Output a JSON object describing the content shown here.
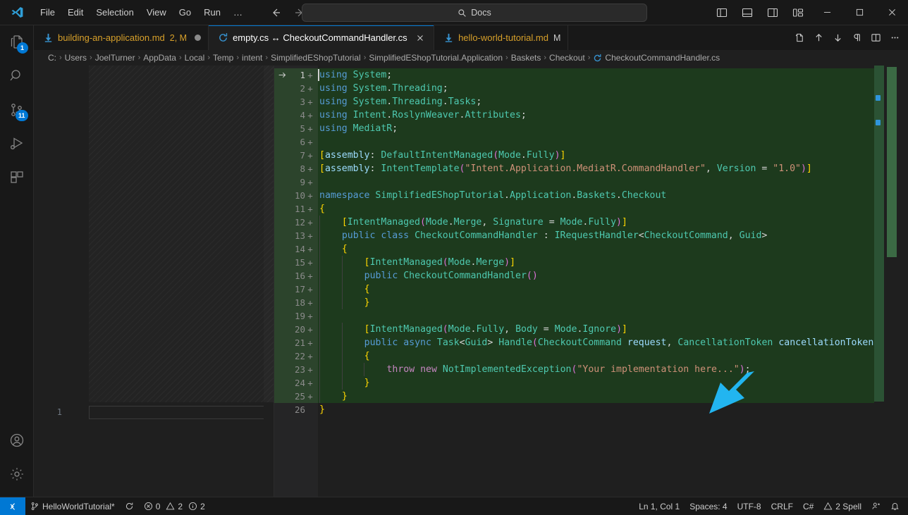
{
  "titlebar": {
    "logo_icon": "vscode-logo-icon",
    "menu": [
      {
        "label": "File"
      },
      {
        "label": "Edit"
      },
      {
        "label": "Selection"
      },
      {
        "label": "View"
      },
      {
        "label": "Go"
      },
      {
        "label": "Run"
      },
      {
        "label": "…"
      }
    ],
    "nav": {
      "back_icon": "arrow-left-icon",
      "forward_icon": "arrow-right-icon"
    },
    "search": {
      "icon": "search-icon",
      "value": "Docs",
      "placeholder": "Search"
    },
    "layout_buttons": [
      {
        "name": "toggle-primary-sidebar",
        "icon": "layout-sidebar-left-icon"
      },
      {
        "name": "toggle-panel",
        "icon": "layout-panel-icon"
      },
      {
        "name": "toggle-secondary-sidebar",
        "icon": "layout-sidebar-right-icon"
      },
      {
        "name": "customize-layout",
        "icon": "layout-customize-icon"
      }
    ],
    "window_buttons": [
      {
        "name": "minimize-button",
        "icon": "minimize-icon"
      },
      {
        "name": "maximize-button",
        "icon": "maximize-icon"
      },
      {
        "name": "close-button",
        "icon": "close-icon"
      }
    ]
  },
  "activitybar": {
    "items": [
      {
        "name": "explorer",
        "icon": "files-icon",
        "badge": "1",
        "active": false
      },
      {
        "name": "search",
        "icon": "search-icon",
        "badge": "",
        "active": false
      },
      {
        "name": "source-control",
        "icon": "source-control-icon",
        "badge": "11",
        "active": false
      },
      {
        "name": "run-and-debug",
        "icon": "run-debug-icon",
        "badge": "",
        "active": false
      },
      {
        "name": "extensions",
        "icon": "extensions-icon",
        "badge": "",
        "active": false
      }
    ],
    "bottom_items": [
      {
        "name": "accounts",
        "icon": "account-icon"
      },
      {
        "name": "manage-settings",
        "icon": "gear-icon"
      }
    ]
  },
  "tabs": [
    {
      "name": "tab-building-an-application",
      "icon": "markdown-download-icon",
      "label": "building-an-application.md",
      "suffix": "2, M",
      "dirty": true,
      "active": false,
      "closable": false
    },
    {
      "name": "tab-empty-cs-diff",
      "icon": "csharp-refresh-icon",
      "label": "empty.cs ↔ CheckoutCommandHandler.cs",
      "suffix": "",
      "dirty": false,
      "active": true,
      "closable": true
    },
    {
      "name": "tab-hello-world-tutorial",
      "icon": "markdown-download-icon",
      "label": "hello-world-tutorial.md",
      "suffix": "M",
      "dirty": false,
      "active": false,
      "closable": false
    }
  ],
  "tabbar_actions": [
    {
      "name": "new-file-button",
      "icon": "new-file-icon"
    },
    {
      "name": "previous-change-button",
      "icon": "arrow-up-icon"
    },
    {
      "name": "next-change-button",
      "icon": "arrow-down-icon"
    },
    {
      "name": "toggle-whitespace-button",
      "icon": "pilcrow-icon"
    },
    {
      "name": "split-editor-button",
      "icon": "split-editor-icon"
    },
    {
      "name": "more-actions-button",
      "icon": "ellipsis-icon"
    }
  ],
  "breadcrumbs": {
    "items": [
      {
        "label": "C:",
        "icon": ""
      },
      {
        "label": "Users",
        "icon": ""
      },
      {
        "label": "JoelTurner",
        "icon": ""
      },
      {
        "label": "AppData",
        "icon": ""
      },
      {
        "label": "Local",
        "icon": ""
      },
      {
        "label": "Temp",
        "icon": ""
      },
      {
        "label": "intent",
        "icon": ""
      },
      {
        "label": "SimplifiedEShopTutorial",
        "icon": ""
      },
      {
        "label": "SimplifiedEShopTutorial.Application",
        "icon": ""
      },
      {
        "label": "Baskets",
        "icon": ""
      },
      {
        "label": "Checkout",
        "icon": ""
      },
      {
        "label": "CheckoutCommandHandler.cs",
        "icon": "csharp-refresh-icon"
      }
    ],
    "separator": "›"
  },
  "diff": {
    "left_pane": {
      "name": "original-empty-file-pane",
      "line_numbers": [
        "1"
      ],
      "content": "",
      "is_empty": true
    },
    "right_pane": {
      "name": "modified-file-pane",
      "marker_icon": "arrow-right-icon",
      "lines": [
        {
          "n": "1",
          "added": true,
          "text": "using System;"
        },
        {
          "n": "2",
          "added": true,
          "text": "using System.Threading;"
        },
        {
          "n": "3",
          "added": true,
          "text": "using System.Threading.Tasks;"
        },
        {
          "n": "4",
          "added": true,
          "text": "using Intent.RoslynWeaver.Attributes;"
        },
        {
          "n": "5",
          "added": true,
          "text": "using MediatR;"
        },
        {
          "n": "6",
          "added": true,
          "text": ""
        },
        {
          "n": "7",
          "added": true,
          "text": "[assembly: DefaultIntentManaged(Mode.Fully)]"
        },
        {
          "n": "8",
          "added": true,
          "text": "[assembly: IntentTemplate(\"Intent.Application.MediatR.CommandHandler\", Version = \"1.0\")]"
        },
        {
          "n": "9",
          "added": true,
          "text": ""
        },
        {
          "n": "10",
          "added": true,
          "text": "namespace SimplifiedEShopTutorial.Application.Baskets.Checkout"
        },
        {
          "n": "11",
          "added": true,
          "text": "{"
        },
        {
          "n": "12",
          "added": true,
          "text": "    [IntentManaged(Mode.Merge, Signature = Mode.Fully)]"
        },
        {
          "n": "13",
          "added": true,
          "text": "    public class CheckoutCommandHandler : IRequestHandler<CheckoutCommand, Guid>"
        },
        {
          "n": "14",
          "added": true,
          "text": "    {"
        },
        {
          "n": "15",
          "added": true,
          "text": "        [IntentManaged(Mode.Merge)]"
        },
        {
          "n": "16",
          "added": true,
          "text": "        public CheckoutCommandHandler()"
        },
        {
          "n": "17",
          "added": true,
          "text": "        {"
        },
        {
          "n": "18",
          "added": true,
          "text": "        }"
        },
        {
          "n": "19",
          "added": true,
          "text": ""
        },
        {
          "n": "20",
          "added": true,
          "text": "        [IntentManaged(Mode.Fully, Body = Mode.Ignore)]"
        },
        {
          "n": "21",
          "added": true,
          "text": "        public async Task<Guid> Handle(CheckoutCommand request, CancellationToken cancellationToken)"
        },
        {
          "n": "22",
          "added": true,
          "text": "        {"
        },
        {
          "n": "23",
          "added": true,
          "text": "            throw new NotImplementedException(\"Your implementation here...\");"
        },
        {
          "n": "24",
          "added": true,
          "text": "        }"
        },
        {
          "n": "25",
          "added": true,
          "text": "    }"
        },
        {
          "n": "26",
          "added": false,
          "text": "}"
        }
      ]
    }
  },
  "annotation": {
    "name": "cyan-pointer-arrow",
    "color": "#22b5f0"
  },
  "statusbar": {
    "remote_icon": "remote-window-icon",
    "left": [
      {
        "name": "branch-status",
        "icon": "source-control-icon",
        "label": "HelloWorldTutorial*"
      },
      {
        "name": "sync-status",
        "icon": "sync-icon",
        "label": ""
      },
      {
        "name": "errors-status",
        "icon": "error-icon",
        "label": "0"
      },
      {
        "name": "warnings-status",
        "icon": "warning-icon",
        "label": "2"
      },
      {
        "name": "info-status",
        "icon": "info-icon",
        "label": "2"
      }
    ],
    "right": [
      {
        "name": "cursor-position",
        "icon": "",
        "label": "Ln 1, Col 1"
      },
      {
        "name": "indentation",
        "icon": "",
        "label": "Spaces: 4"
      },
      {
        "name": "encoding",
        "icon": "",
        "label": "UTF-8"
      },
      {
        "name": "eol",
        "icon": "",
        "label": "CRLF"
      },
      {
        "name": "language-mode",
        "icon": "",
        "label": "C#"
      },
      {
        "name": "spell-checker",
        "icon": "warning-icon",
        "label": "2 Spell"
      },
      {
        "name": "remote-share",
        "icon": "live-share-icon",
        "label": ""
      },
      {
        "name": "notifications",
        "icon": "bell-icon",
        "label": ""
      }
    ]
  },
  "colors": {
    "accent": "#0078d4",
    "added_bg": "#1d3a1d",
    "gutter_added_bg": "#2c442c",
    "titlebar_bg": "#181818",
    "editor_bg": "#1f1f1f"
  }
}
